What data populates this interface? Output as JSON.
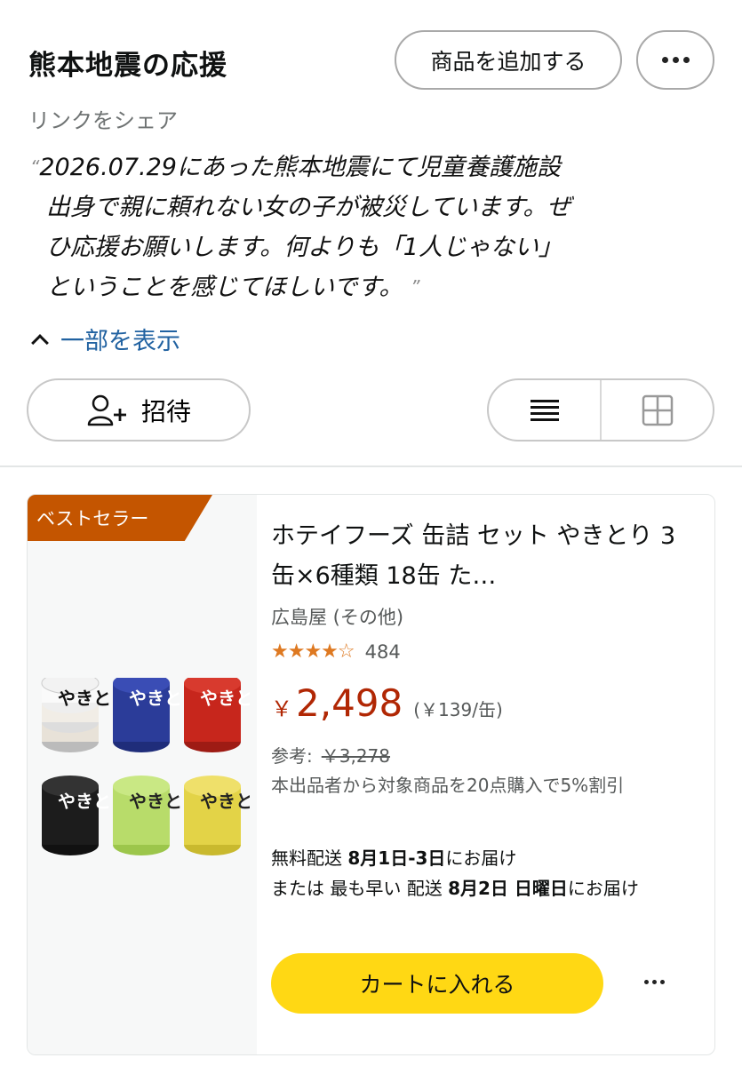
{
  "header": {
    "title": "熊本地震の応援",
    "add_button": "商品を追加する",
    "more_icon": "ellipsis-icon"
  },
  "share_link": "リンクをシェア",
  "description": {
    "open_quote": "“",
    "close_quote": "”",
    "lines": [
      "2026.07.29にあった熊本地震にて児童養護施設",
      "出身で親に頼れない女の子が被災しています。ぜ",
      "ひ応援お願いします。何よりも「1人じゃない」",
      "ということを感じてほしいです。"
    ]
  },
  "collapse_link": "一部を表示",
  "invite_button": "招待",
  "view_toggle": {
    "list_icon": "list-icon",
    "grid_icon": "grid-icon"
  },
  "product": {
    "badge": "ベストセラー",
    "title": "ホテイフーズ 缶詰 セット やきとり 3缶×6種類 18缶 た…",
    "seller": "広島屋 (その他)",
    "rating": 4.5,
    "stars": "★★★★☆",
    "review_count": "484",
    "price_symbol": "￥",
    "price": "2,498",
    "unit_price": "(￥139/缶)",
    "reference_label": "参考:",
    "reference_price": "￥3,278",
    "promo": "本出品者から対象商品を20点購入で5%割引",
    "delivery_line1_prefix": "無料配送 ",
    "delivery_line1_date": "8月1日-3日",
    "delivery_line1_suffix": "にお届け",
    "delivery_line2_prefix": "または 最も早い 配送 ",
    "delivery_line2_date": "8月2日 日曜日",
    "delivery_line2_suffix": "にお届け",
    "cart_button": "カートに入れる",
    "can_labels": [
      "やきとり",
      "やきとり",
      "やきとり",
      "やきとり",
      "やきとり",
      "やきとり"
    ]
  },
  "colors": {
    "link": "#2162a1",
    "badge": "#c45500",
    "price": "#b12704",
    "star": "#de7921",
    "cart": "#ffd814"
  }
}
